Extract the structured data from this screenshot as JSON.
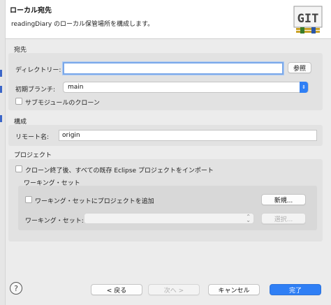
{
  "header": {
    "title": "ローカル宛先",
    "description": "readingDiary のローカル保管場所を構成します。",
    "logo_text": "GIT"
  },
  "destination": {
    "group_label": "宛先",
    "directory_label": "ディレクトリー:",
    "directory_value": "",
    "browse_label": "参照",
    "branch_label": "初期ブランチ:",
    "branch_value": "main",
    "submodule_label": "サブモジュールのクローン"
  },
  "config": {
    "group_label": "構成",
    "remote_label": "リモート名:",
    "remote_value": "origin"
  },
  "project": {
    "group_label": "プロジェクト",
    "import_label": "クローン終了後、すべての既存 Eclipse プロジェクトをインポート",
    "working_set_group": "ワーキング・セット",
    "add_to_ws_label": "ワーキング・セットにプロジェクトを追加",
    "new_label": "新規...",
    "ws_label": "ワーキング・セット:",
    "ws_value": "",
    "select_label": "選択..."
  },
  "footer": {
    "help": "?",
    "back_label": "< 戻る",
    "next_label": "次へ >",
    "cancel_label": "キャンセル",
    "finish_label": "完了"
  },
  "colors": {
    "accent": "#2f7ff5",
    "focus_ring": "#7ba8e9"
  }
}
